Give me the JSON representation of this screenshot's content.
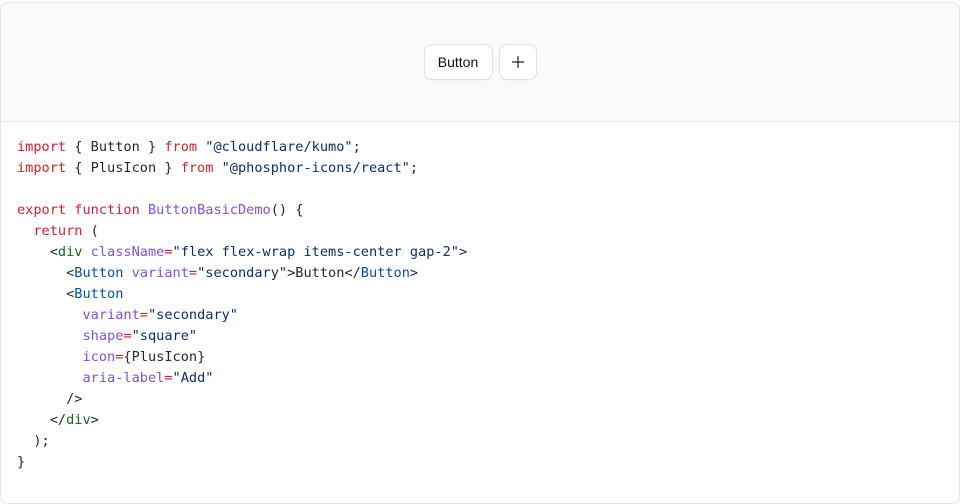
{
  "preview": {
    "button_label": "Button",
    "icon_button_aria": "Add",
    "icon": "plus-icon"
  },
  "code": {
    "lines": [
      [
        {
          "t": "kw",
          "v": "import"
        },
        {
          "t": "pl",
          "v": " { Button } "
        },
        {
          "t": "kw",
          "v": "from"
        },
        {
          "t": "pl",
          "v": " "
        },
        {
          "t": "str",
          "v": "\"@cloudflare/kumo\""
        },
        {
          "t": "pl",
          "v": ";"
        }
      ],
      [
        {
          "t": "kw",
          "v": "import"
        },
        {
          "t": "pl",
          "v": " { PlusIcon } "
        },
        {
          "t": "kw",
          "v": "from"
        },
        {
          "t": "pl",
          "v": " "
        },
        {
          "t": "str",
          "v": "\"@phosphor-icons/react\""
        },
        {
          "t": "pl",
          "v": ";"
        }
      ],
      [],
      [
        {
          "t": "kw",
          "v": "export"
        },
        {
          "t": "pl",
          "v": " "
        },
        {
          "t": "kw",
          "v": "function"
        },
        {
          "t": "pl",
          "v": " "
        },
        {
          "t": "fn",
          "v": "ButtonBasicDemo"
        },
        {
          "t": "pl",
          "v": "() {"
        }
      ],
      [
        {
          "t": "pl",
          "v": "  "
        },
        {
          "t": "kw",
          "v": "return"
        },
        {
          "t": "pl",
          "v": " ("
        }
      ],
      [
        {
          "t": "pl",
          "v": "    <"
        },
        {
          "t": "tag",
          "v": "div"
        },
        {
          "t": "pl",
          "v": " "
        },
        {
          "t": "attr",
          "v": "className"
        },
        {
          "t": "op",
          "v": "="
        },
        {
          "t": "str",
          "v": "\"flex flex-wrap items-center gap-2\""
        },
        {
          "t": "pl",
          "v": ">"
        }
      ],
      [
        {
          "t": "pl",
          "v": "      <"
        },
        {
          "t": "comp",
          "v": "Button"
        },
        {
          "t": "pl",
          "v": " "
        },
        {
          "t": "attr",
          "v": "variant"
        },
        {
          "t": "op",
          "v": "="
        },
        {
          "t": "str",
          "v": "\"secondary\""
        },
        {
          "t": "pl",
          "v": ">Button</"
        },
        {
          "t": "comp",
          "v": "Button"
        },
        {
          "t": "pl",
          "v": ">"
        }
      ],
      [
        {
          "t": "pl",
          "v": "      <"
        },
        {
          "t": "comp",
          "v": "Button"
        }
      ],
      [
        {
          "t": "pl",
          "v": "        "
        },
        {
          "t": "attr",
          "v": "variant"
        },
        {
          "t": "op",
          "v": "="
        },
        {
          "t": "str",
          "v": "\"secondary\""
        }
      ],
      [
        {
          "t": "pl",
          "v": "        "
        },
        {
          "t": "attr",
          "v": "shape"
        },
        {
          "t": "op",
          "v": "="
        },
        {
          "t": "str",
          "v": "\"square\""
        }
      ],
      [
        {
          "t": "pl",
          "v": "        "
        },
        {
          "t": "attr",
          "v": "icon"
        },
        {
          "t": "op",
          "v": "="
        },
        {
          "t": "pl",
          "v": "{PlusIcon}"
        }
      ],
      [
        {
          "t": "pl",
          "v": "        "
        },
        {
          "t": "attr",
          "v": "aria-label"
        },
        {
          "t": "op",
          "v": "="
        },
        {
          "t": "str",
          "v": "\"Add\""
        }
      ],
      [
        {
          "t": "pl",
          "v": "      />"
        }
      ],
      [
        {
          "t": "pl",
          "v": "    </"
        },
        {
          "t": "tag",
          "v": "div"
        },
        {
          "t": "pl",
          "v": ">"
        }
      ],
      [
        {
          "t": "pl",
          "v": "  );"
        }
      ],
      [
        {
          "t": "pl",
          "v": "}"
        }
      ]
    ]
  }
}
